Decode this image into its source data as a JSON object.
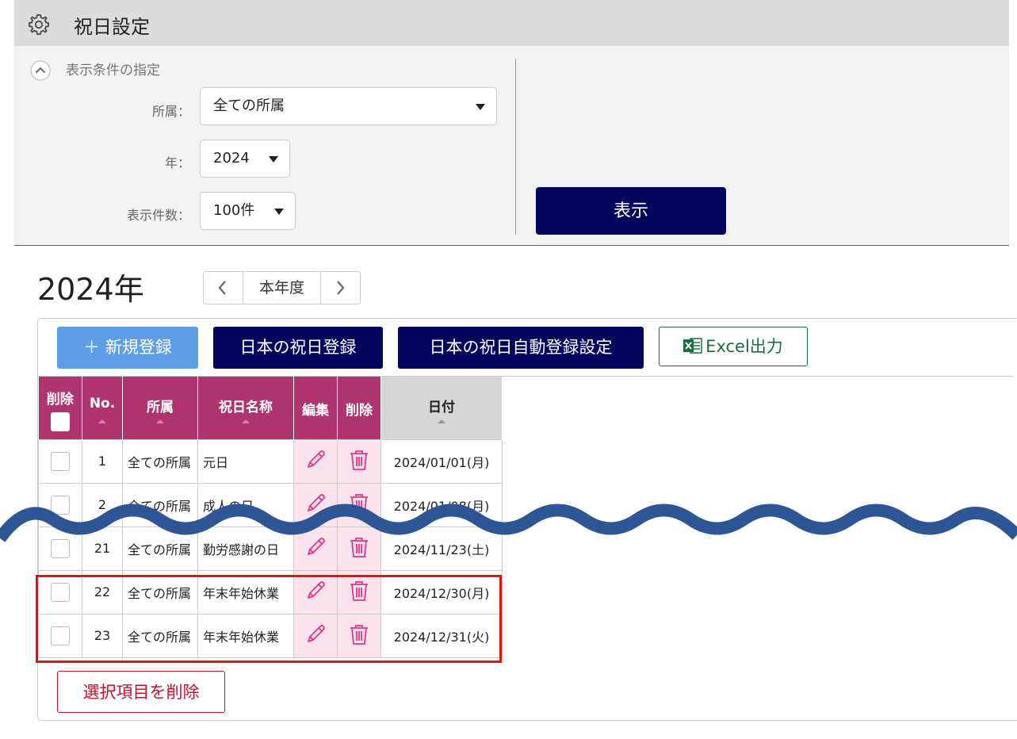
{
  "header": {
    "title": "祝日設定",
    "icon": "gear-icon"
  },
  "conditions": {
    "title": "表示条件の指定",
    "affiliation_label": "所属：",
    "affiliation_value": "全ての所属",
    "year_label": "年：",
    "year_value": "2024",
    "count_label": "表示件数：",
    "count_value": "100件",
    "show_button": "表示"
  },
  "year_heading": "2024年",
  "year_nav": {
    "current": "本年度"
  },
  "toolbar": {
    "new_button": "＋ 新規登録",
    "jp_holiday_button": "日本の祝日登録",
    "auto_register_button": "日本の祝日自動登録設定",
    "excel_button": "Excel出力"
  },
  "table": {
    "headers": {
      "delete": "削除",
      "no": "No.",
      "affiliation": "所属",
      "holiday_name": "祝日名称",
      "edit": "編集",
      "delete2": "削除",
      "date": "日付"
    },
    "rows": [
      {
        "no": "1",
        "affiliation": "全ての所属",
        "name": "元日",
        "date": "2024/01/01(月)"
      },
      {
        "no": "2",
        "affiliation": "全ての所属",
        "name": "成人の日",
        "date": "2024/01/08(月)"
      },
      {
        "no": "21",
        "affiliation": "全ての所属",
        "name": "勤労感謝の日",
        "date": "2024/11/23(土)"
      },
      {
        "no": "22",
        "affiliation": "全ての所属",
        "name": "年末年始休業",
        "date": "2024/12/30(月)"
      },
      {
        "no": "23",
        "affiliation": "全ての所属",
        "name": "年末年始休業",
        "date": "2024/12/31(火)"
      }
    ]
  },
  "delete_selected_button": "選択項目を削除",
  "colors": {
    "header_bg": "#dcdcdc",
    "primary_dark": "#05055e",
    "accent_blue": "#5c9fe8",
    "table_header": "#b0356f",
    "action_cell": "#fbe3ee",
    "icon_pink": "#e0368a",
    "excel_green": "#1d6e3f",
    "highlight_red": "#e11212",
    "wave_blue": "#2e5596"
  }
}
